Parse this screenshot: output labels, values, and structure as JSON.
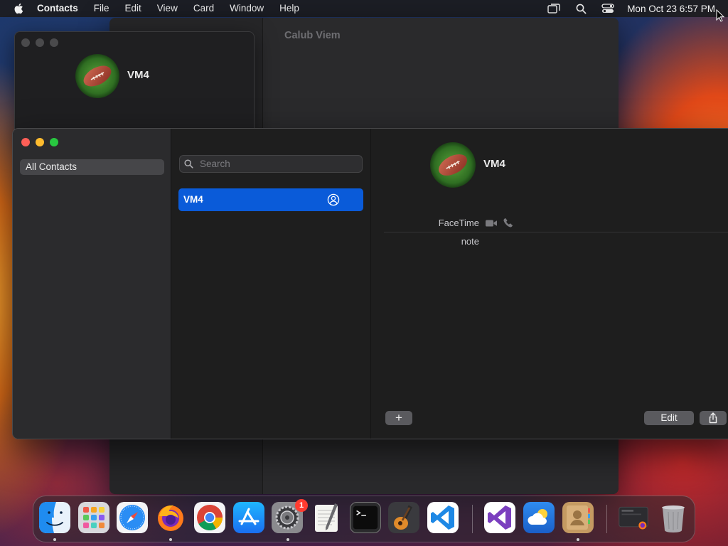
{
  "menubar": {
    "app_name": "Contacts",
    "items": [
      "File",
      "Edit",
      "View",
      "Card",
      "Window",
      "Help"
    ],
    "clock": "Mon Oct 23  6:57 PM",
    "icons": [
      "apple-icon",
      "screen-mirroring-icon",
      "spotlight-search-icon",
      "control-center-icon"
    ]
  },
  "background_window": {
    "title": "Calub Viem"
  },
  "small_window": {
    "contact_name": "VM4"
  },
  "sidebar": {
    "groups": [
      {
        "label": "All Contacts",
        "selected": true
      }
    ]
  },
  "list": {
    "search_placeholder": "Search",
    "contacts": [
      {
        "name": "VM4",
        "selected": true,
        "is_me": true
      }
    ]
  },
  "detail": {
    "name": "VM4",
    "facetime_label": "FaceTime",
    "note_label": "note",
    "add_label": "+",
    "edit_label": "Edit"
  },
  "dock": {
    "apps": [
      {
        "name": "Finder",
        "running": true
      },
      {
        "name": "Launchpad",
        "running": false
      },
      {
        "name": "Safari",
        "running": false
      },
      {
        "name": "Firefox",
        "running": true
      },
      {
        "name": "Google Chrome",
        "running": false
      },
      {
        "name": "App Store",
        "running": false
      },
      {
        "name": "System Settings",
        "running": true,
        "badge": "1"
      },
      {
        "name": "TextEdit",
        "running": false
      },
      {
        "name": "Terminal",
        "running": false
      },
      {
        "name": "GarageBand",
        "running": false
      },
      {
        "name": "Visual Studio Code",
        "running": false
      },
      {
        "name": "Visual Studio",
        "running": false
      },
      {
        "name": "Weather",
        "running": false
      },
      {
        "name": "Contacts",
        "running": true
      },
      {
        "name": "Downloads",
        "running": false
      },
      {
        "name": "Trash",
        "running": false
      }
    ]
  },
  "colors": {
    "accent": "#0a5bd9",
    "close": "#fe5f57",
    "minimize": "#febc2e",
    "zoom": "#28c840",
    "badge": "#ff3b30"
  }
}
